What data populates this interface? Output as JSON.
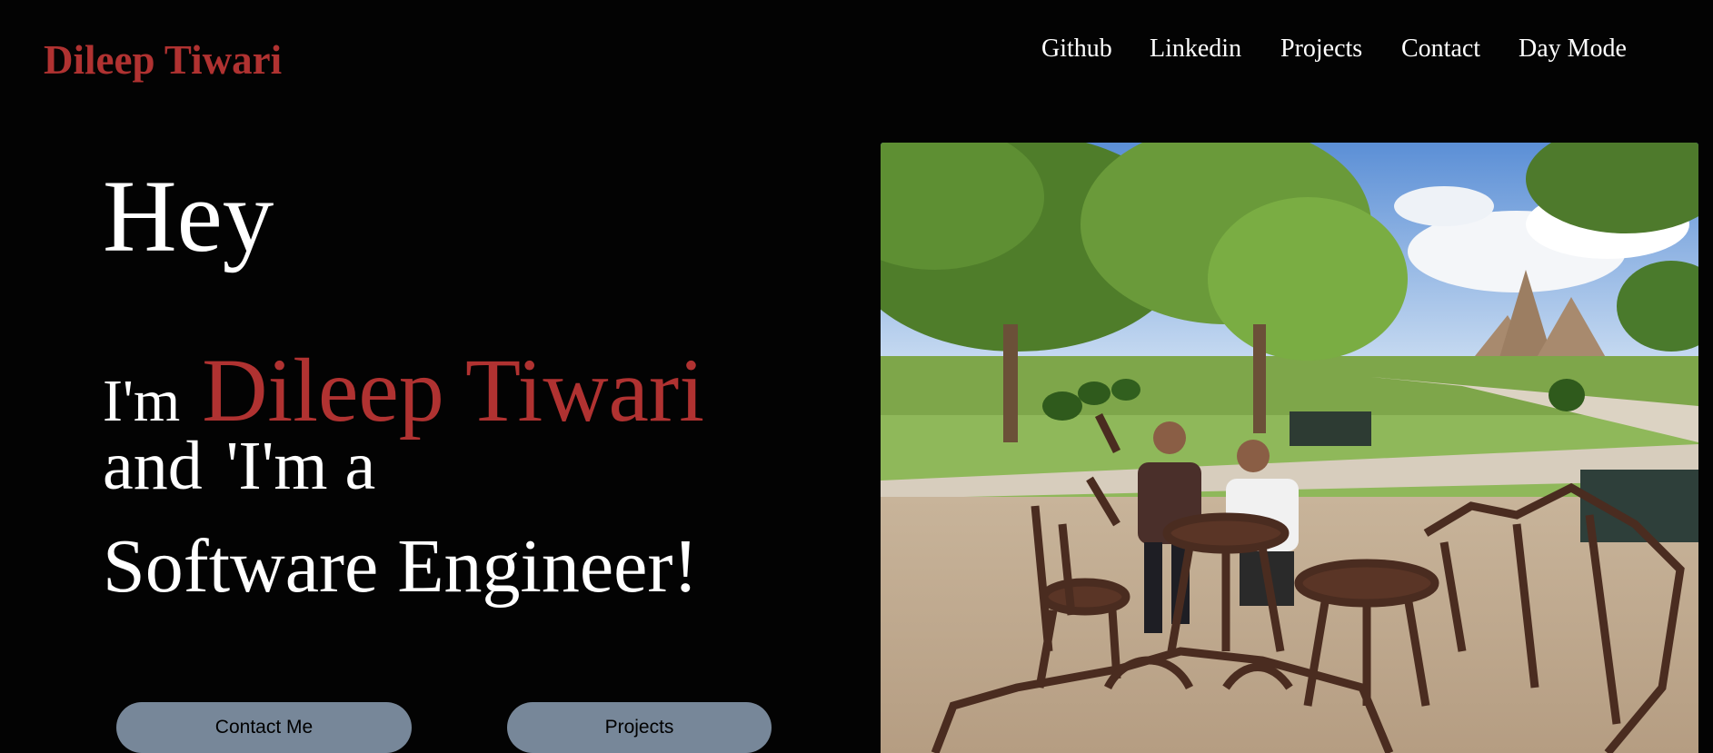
{
  "brand": {
    "name": "Dileep Tiwari"
  },
  "nav": {
    "items": [
      {
        "label": "Github"
      },
      {
        "label": "Linkedin"
      },
      {
        "label": "Projects"
      },
      {
        "label": "Contact"
      },
      {
        "label": "Day Mode"
      }
    ]
  },
  "hero": {
    "greeting": "Hey",
    "intro_prefix": "I'm",
    "name": "Dileep Tiwari",
    "and_word": "and",
    "typed_text": "'I'm a",
    "role": "Software Engineer!"
  },
  "buttons": {
    "contact_label": "Contact Me",
    "projects_label": "Projects"
  },
  "colors": {
    "accent": "#b03231",
    "background": "#030303",
    "button": "#778799"
  }
}
